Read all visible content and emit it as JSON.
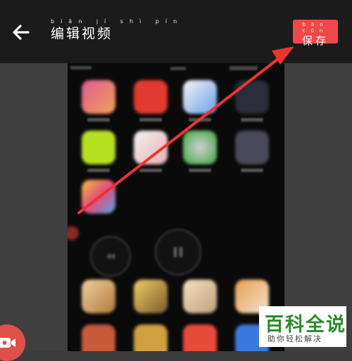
{
  "header": {
    "back_icon": "arrow-left-icon",
    "title_pinyin": "biān jí shì pín",
    "title": "编辑视频",
    "save_pinyin": "bǎo cún",
    "save_label": "保存"
  },
  "sidebar": {
    "record_icon": "video-camera-icon"
  },
  "watermark": {
    "line1": "百科全说",
    "line2": "助你轻松解决"
  },
  "colors": {
    "accent": "#ef4848",
    "topbar": "#1b1b1b",
    "watermark_green": "#2a8c2a"
  }
}
